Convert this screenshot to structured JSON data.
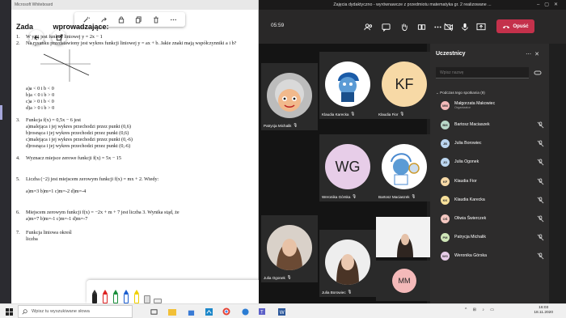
{
  "whiteboard": {
    "window_title": "Microsoft Whiteboard",
    "heading_visible": "Zada",
    "heading_tail": " wprowadzające:",
    "tasks": [
      {
        "num": "1.",
        "text": "W yjaj      jest funkcji liniowej y = 2x − 1"
      },
      {
        "num": "2.",
        "text": "Na rysunku przedstawiony jest wykres funkcji liniowej y = ax + b. Jakie znaki mają współczynniki a i b?"
      }
    ],
    "task2_options": [
      "a)a < 0 i b < 0",
      "b)a < 0 i b > 0",
      "c)a > 0 i b < 0",
      "d)a > 0 i b > 0"
    ],
    "task3": {
      "num": "3.",
      "text": "Funkcja f(x) = 0,5x − 6 jest",
      "options": [
        "a)malejąca i jej wykres przechodzi przez punkt (0,6)",
        "b)rosnąca i jej wykres przechodzi przez punkt (0,6)",
        "c)malejąca i jej wykres przechodzi przez punkt (0,-6)",
        "d)rosnąca i jej wykres przechodzi przez punkt (0,-6)"
      ]
    },
    "task4": {
      "num": "4.",
      "text": "Wyznacz miejsce zerowe funkcji f(x) = 5x − 15"
    },
    "task5": {
      "num": "5.",
      "text": "Liczba (−2) jest miejscem zerowym funkcji f(x) = mx + 2. Wtedy:",
      "answers": "a)m=3   b)m=1   c)m=-2   d)m=-4"
    },
    "task6": {
      "num": "6.",
      "text": "Miejscem zerowym funkcji f(x) = −2x + m + 7 jest liczba 3. Wynika stąd, że",
      "answers": "a)m=7   b)m=-1   c)m=-1   d)m=-7"
    },
    "task7": {
      "num": "7.",
      "text": "Funkcja liniowa określ",
      "text2": "liczba"
    }
  },
  "meeting": {
    "title": "Zajęcia dydaktyczno - wyrównawcze z przedmiotu matematyka gr. 2 realizowane ...",
    "time": "05:59",
    "leave_label": "Opuść",
    "tiles": [
      {
        "name": "Patrycja Michalik"
      },
      {
        "name": "Klaudia Karecka"
      },
      {
        "name": "Klaudia Fior",
        "initials": "KF"
      },
      {
        "name": "Weronika Górska",
        "initials": "WG"
      },
      {
        "name": "Bartosz Maciaszek"
      },
      {
        "name": "Julia Ogonek"
      },
      {
        "name": "Julia Borowiec"
      },
      {
        "name": "",
        "initials": "MM"
      }
    ]
  },
  "participants": {
    "title": "Uczestnicy",
    "invite_placeholder": "Wpisz nazwę",
    "section": "Podczas tego spotkania (9)",
    "list": [
      {
        "initials": "MM",
        "name": "Małgorzata Makowiec",
        "role": "Organizator",
        "color": "#f4b9b9"
      },
      {
        "initials": "BM",
        "name": "Bartosz Maciaszek",
        "role": "",
        "color": "#b8d8c8"
      },
      {
        "initials": "JB",
        "name": "Julia Borowiec",
        "role": "",
        "color": "#bcd6f0"
      },
      {
        "initials": "JO",
        "name": "Julia Ogonek",
        "role": "",
        "color": "#bcd6f0"
      },
      {
        "initials": "KF",
        "name": "Klaudia Fior",
        "role": "",
        "color": "#f7d9a6"
      },
      {
        "initials": "KK",
        "name": "Klaudia Karecka",
        "role": "",
        "color": "#f7e09a"
      },
      {
        "initials": "OŚ",
        "name": "Oliwia Świerczek",
        "role": "",
        "color": "#f4c7c0"
      },
      {
        "initials": "PM",
        "name": "Patrycja Michalik",
        "role": "",
        "color": "#cfe6b8"
      },
      {
        "initials": "WG",
        "name": "Weronika Górska",
        "role": "",
        "color": "#e7cde8"
      }
    ]
  },
  "taskbar": {
    "search_placeholder": "Wpisz tu wyszukiwane słowa",
    "time": "16:03",
    "date": "18.11.2020"
  },
  "colors": {
    "leave": "#c4314b",
    "teams_bg": "#1f1f1f",
    "panel_bg": "#2d2c2c"
  }
}
